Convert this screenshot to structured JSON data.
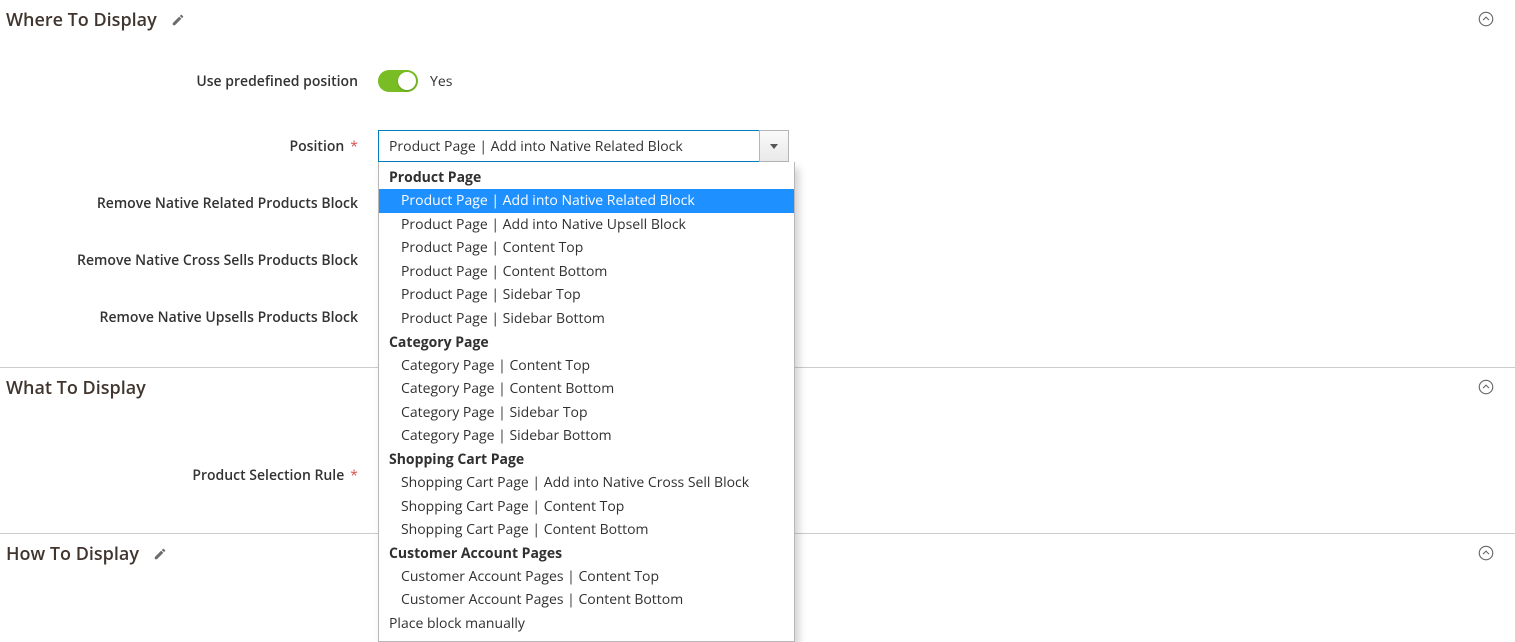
{
  "sections": {
    "where": {
      "title": "Where To Display"
    },
    "what": {
      "title": "What To Display"
    },
    "how": {
      "title": "How To Display"
    }
  },
  "fields": {
    "use_predefined": {
      "label": "Use predefined position",
      "value_label": "Yes"
    },
    "position": {
      "label": "Position",
      "selected": "Product Page | Add into Native Related Block",
      "groups": [
        {
          "label": "Product Page",
          "options": [
            "Product Page | Add into Native Related Block",
            "Product Page | Add into Native Upsell Block",
            "Product Page | Content Top",
            "Product Page | Content Bottom",
            "Product Page | Sidebar Top",
            "Product Page | Sidebar Bottom"
          ]
        },
        {
          "label": "Category Page",
          "options": [
            "Category Page | Content Top",
            "Category Page | Content Bottom",
            "Category Page | Sidebar Top",
            "Category Page | Sidebar Bottom"
          ]
        },
        {
          "label": "Shopping Cart Page",
          "options": [
            "Shopping Cart Page | Add into Native Cross Sell Block",
            "Shopping Cart Page | Content Top",
            "Shopping Cart Page | Content Bottom"
          ]
        },
        {
          "label": "Customer Account Pages",
          "options": [
            "Customer Account Pages | Content Top",
            "Customer Account Pages | Content Bottom"
          ]
        }
      ],
      "plain_option": "Place block manually"
    },
    "remove_related": {
      "label": "Remove Native Related Products Block"
    },
    "remove_crosssell": {
      "label": "Remove Native Cross Sells Products Block"
    },
    "remove_upsell": {
      "label": "Remove Native Upsells Products Block"
    },
    "product_selection_rule": {
      "label": "Product Selection Rule"
    }
  },
  "colors": {
    "accent_border": "#007dbd",
    "highlight": "#1e90ff",
    "toggle_on": "#78bd23"
  }
}
